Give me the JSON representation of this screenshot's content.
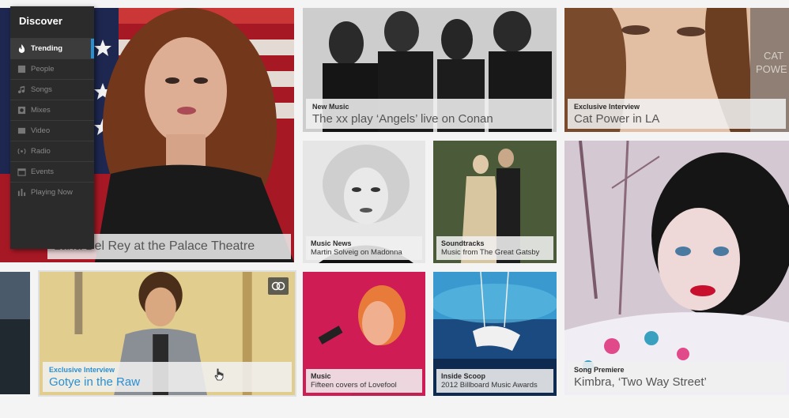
{
  "sidebar": {
    "title": "Discover",
    "items": [
      {
        "label": "Trending",
        "icon": "flame-icon",
        "active": true
      },
      {
        "label": "People",
        "icon": "people-icon",
        "active": false
      },
      {
        "label": "Songs",
        "icon": "music-note-icon",
        "active": false
      },
      {
        "label": "Mixes",
        "icon": "mix-icon",
        "active": false
      },
      {
        "label": "Video",
        "icon": "video-icon",
        "active": false
      },
      {
        "label": "Radio",
        "icon": "radio-icon",
        "active": false
      },
      {
        "label": "Events",
        "icon": "calendar-icon",
        "active": false
      },
      {
        "label": "Playing Now",
        "icon": "bars-icon",
        "active": false
      }
    ]
  },
  "tiles": {
    "lana": {
      "title": "Lana Del Rey at the Palace Theatre"
    },
    "xx": {
      "category": "New Music",
      "title": "The xx play ‘Angels’ live on Conan"
    },
    "catpower": {
      "category": "Exclusive Interview",
      "title": "Cat Power in LA"
    },
    "madonna": {
      "category": "Music News",
      "title": "Martin Solveig on Madonna"
    },
    "gatsby": {
      "category": "Soundtracks",
      "title": "Music from The Great Gatsby"
    },
    "kimbra": {
      "category": "Song Premiere",
      "title": "Kimbra, ‘Two Way Street’"
    },
    "gotye": {
      "category": "Exclusive Interview",
      "title": "Gotye in the Raw"
    },
    "lovefool": {
      "category": "Music",
      "title": "Fifteen covers of Lovefool"
    },
    "billboard": {
      "category": "Inside Scoop",
      "title": "2012 Billboard Music Awards"
    }
  },
  "colors": {
    "accent": "#2a8fd1",
    "sidebar": "#2b2b2b"
  }
}
